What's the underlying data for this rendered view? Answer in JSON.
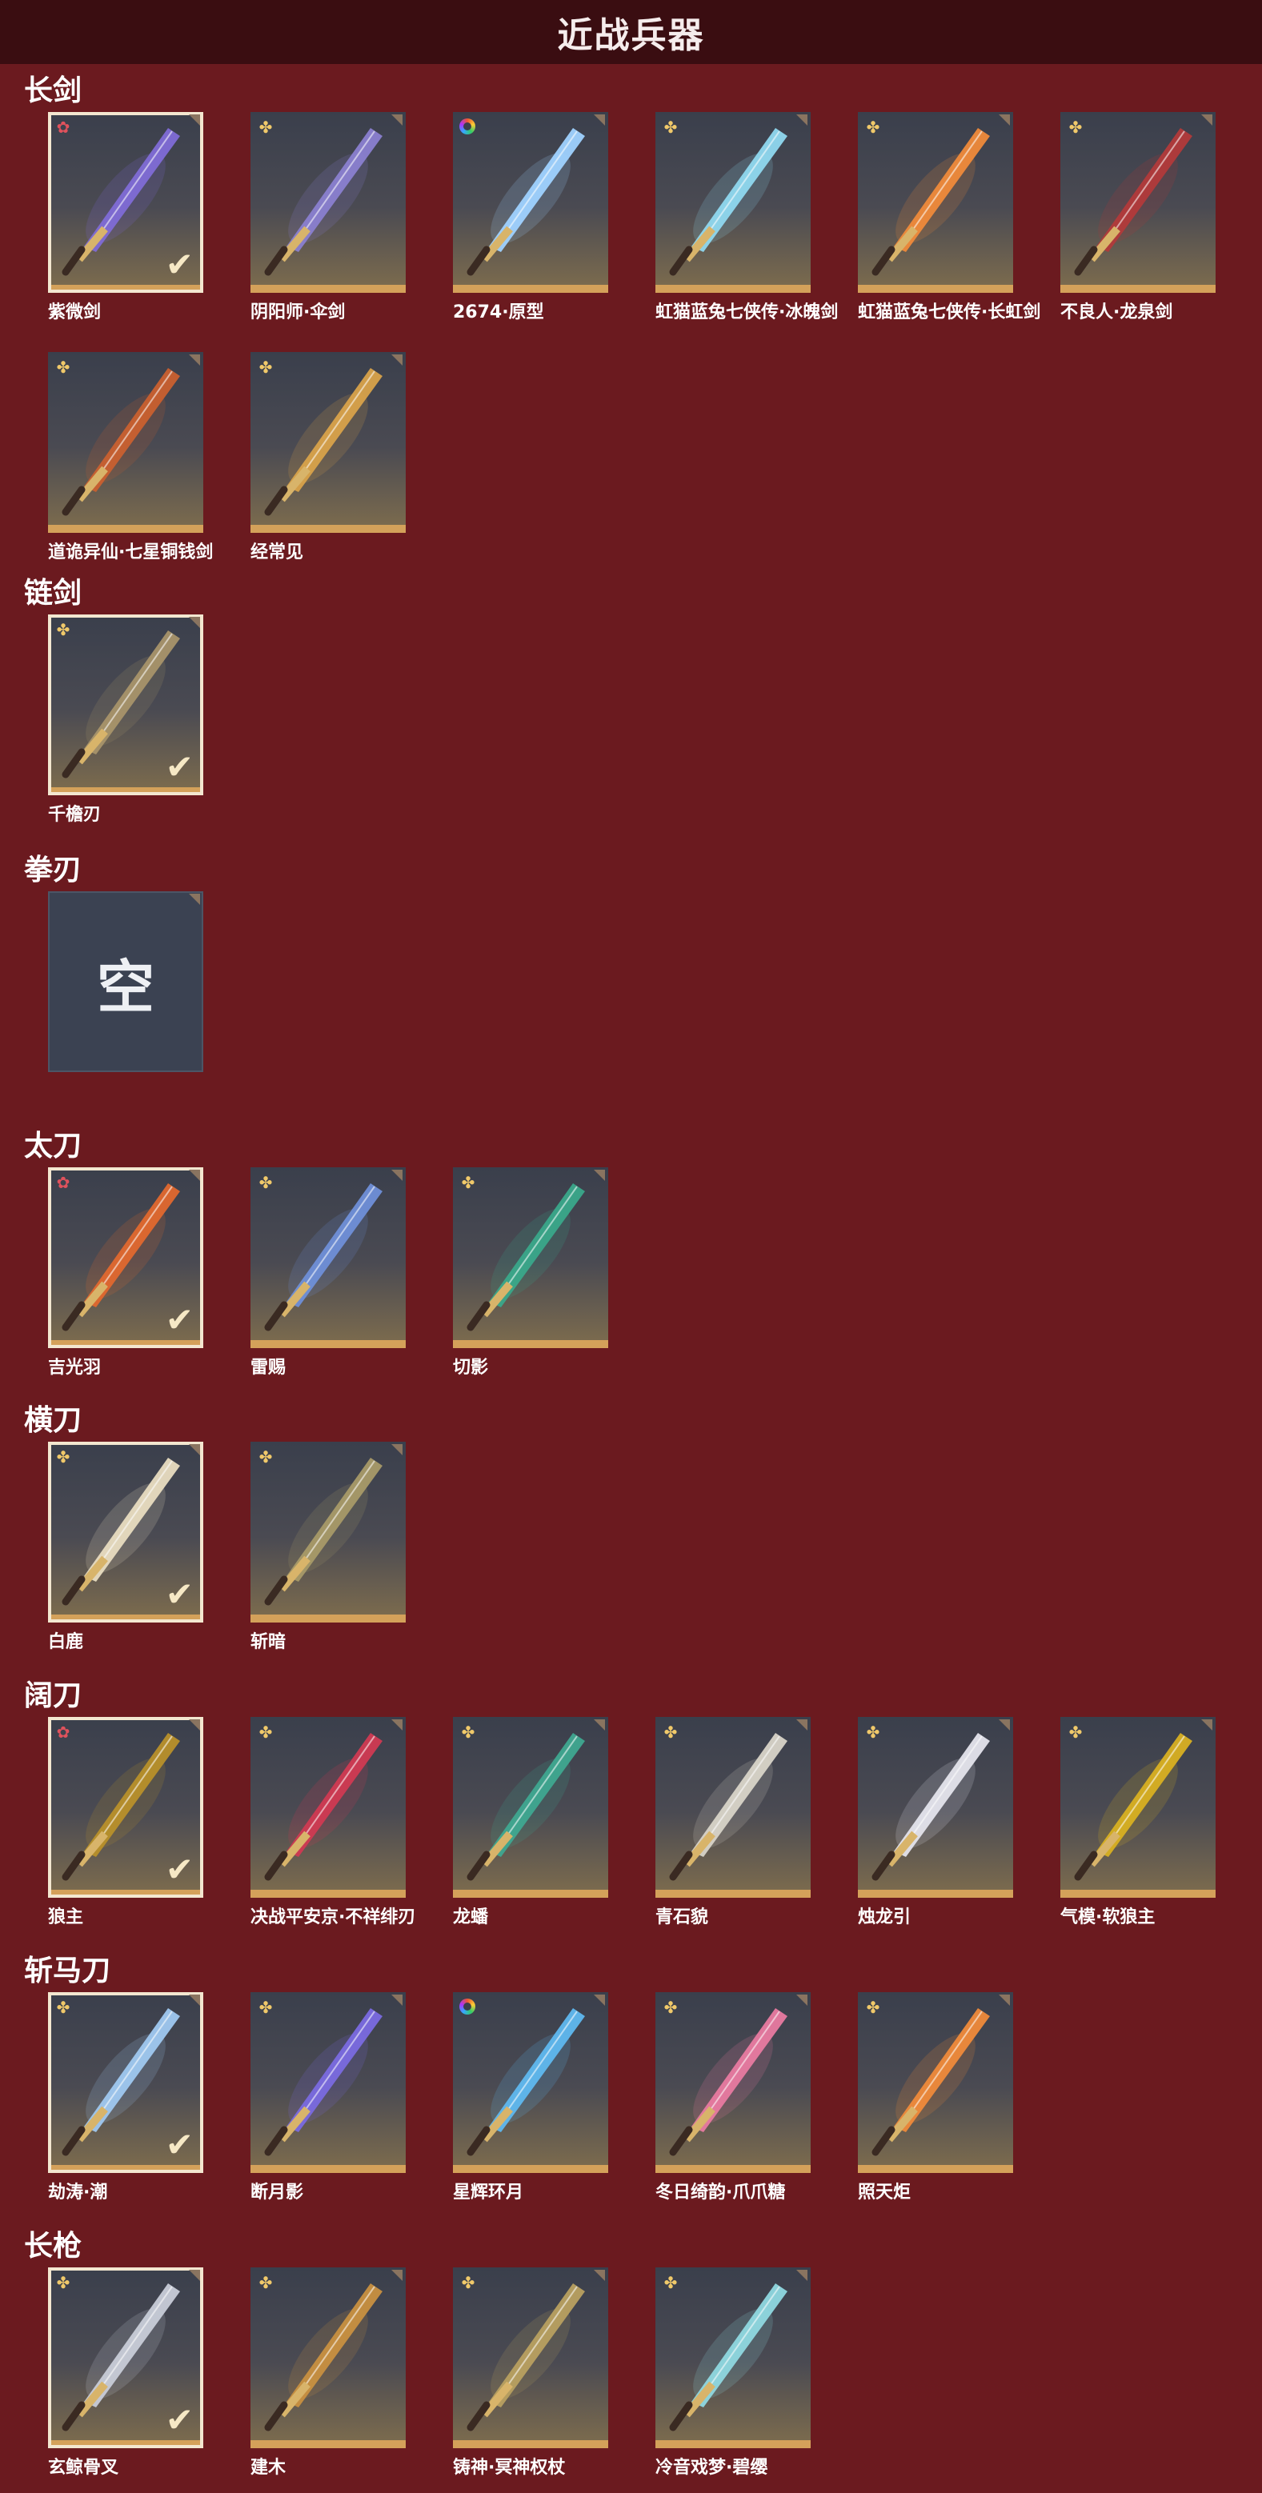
{
  "title": "近战兵器",
  "sections": {
    "changjian": {
      "title": "长剑",
      "items": [
        {
          "name": "紫微剑",
          "rarity": "red",
          "selected": true,
          "weapon_icon": "sword-icon",
          "color": "#7f6bd6"
        },
        {
          "name": "阴阳师·伞剑",
          "rarity": "gold",
          "selected": false,
          "weapon_icon": "umbrella-sword-icon",
          "color": "#8a7fd0"
        },
        {
          "name": "2674·原型",
          "rarity": "rainbow",
          "selected": false,
          "weapon_icon": "lightsaber-icon",
          "color": "#9fd2ff"
        },
        {
          "name": "虹猫蓝兔七侠传·冰魄剑",
          "rarity": "gold",
          "selected": false,
          "weapon_icon": "ice-sword-icon",
          "color": "#8fd8ef"
        },
        {
          "name": "虹猫蓝兔七侠传·长虹剑",
          "rarity": "gold",
          "selected": false,
          "weapon_icon": "fire-sword-icon",
          "color": "#ef8a3a"
        },
        {
          "name": "不良人·龙泉剑",
          "rarity": "gold",
          "selected": false,
          "weapon_icon": "dragon-sword-icon",
          "color": "#b23a3a"
        },
        {
          "name": "道诡异仙·七星铜钱剑",
          "rarity": "gold",
          "selected": false,
          "weapon_icon": "coin-sword-icon",
          "color": "#c9602f"
        },
        {
          "name": "经常见",
          "rarity": "gold",
          "selected": false,
          "weapon_icon": "golden-sword-icon",
          "color": "#d8a24a"
        }
      ]
    },
    "lianjian": {
      "title": "链剑",
      "items": [
        {
          "name": "千檐刃",
          "rarity": "gold",
          "selected": true,
          "weapon_icon": "chain-sword-icon",
          "color": "#a8946a"
        }
      ]
    },
    "quanren": {
      "title": "拳刃",
      "empty_label": "空"
    },
    "taidao": {
      "title": "太刀",
      "items": [
        {
          "name": "吉光羽",
          "rarity": "red",
          "selected": true,
          "weapon_icon": "katana-icon",
          "color": "#e0682e"
        },
        {
          "name": "雷赐",
          "rarity": "gold",
          "selected": false,
          "weapon_icon": "thunder-blade-icon",
          "color": "#6f8fd8"
        },
        {
          "name": "切影",
          "rarity": "gold",
          "selected": false,
          "weapon_icon": "shadow-blade-icon",
          "color": "#3aa88a"
        }
      ]
    },
    "hengdao": {
      "title": "横刀",
      "items": [
        {
          "name": "白鹿",
          "rarity": "gold",
          "selected": true,
          "weapon_icon": "white-saber-icon",
          "color": "#e8dcc0"
        },
        {
          "name": "斩暗",
          "rarity": "gold",
          "selected": false,
          "weapon_icon": "dark-saber-icon",
          "color": "#a89a68"
        }
      ]
    },
    "kuodao": {
      "title": "阔刀",
      "items": [
        {
          "name": "狼主",
          "rarity": "red",
          "selected": true,
          "weapon_icon": "broad-blade-icon",
          "color": "#b8902a"
        },
        {
          "name": "决战平安京·不祥绯刃",
          "rarity": "gold",
          "selected": false,
          "weapon_icon": "crimson-blade-icon",
          "color": "#d03a52"
        },
        {
          "name": "龙蟠",
          "rarity": "gold",
          "selected": false,
          "weapon_icon": "jade-blade-icon",
          "color": "#3fa890"
        },
        {
          "name": "青石貌",
          "rarity": "gold",
          "selected": false,
          "weapon_icon": "stone-blade-icon",
          "color": "#d8d4c8"
        },
        {
          "name": "烛龙引",
          "rarity": "gold",
          "selected": false,
          "weapon_icon": "candle-dragon-blade-icon",
          "color": "#e4e4ec"
        },
        {
          "name": "气模·软狼主",
          "rarity": "gold",
          "selected": false,
          "weapon_icon": "inflatable-blade-icon",
          "color": "#d8b022"
        }
      ]
    },
    "zhanmadao": {
      "title": "斩马刀",
      "items": [
        {
          "name": "劫涛·潮",
          "rarity": "gold",
          "selected": true,
          "weapon_icon": "wave-glaive-icon",
          "color": "#9fc8f0"
        },
        {
          "name": "断月影",
          "rarity": "gold",
          "selected": false,
          "weapon_icon": "moon-glaive-icon",
          "color": "#7a6ae0"
        },
        {
          "name": "星辉环月",
          "rarity": "rainbow",
          "selected": false,
          "weapon_icon": "star-ring-glaive-icon",
          "color": "#5fb8ef"
        },
        {
          "name": "冬日绮韵·爪爪糖",
          "rarity": "gold",
          "selected": false,
          "weapon_icon": "paw-candy-icon",
          "color": "#e87aa0"
        },
        {
          "name": "照天炬",
          "rarity": "gold",
          "selected": false,
          "weapon_icon": "torch-glaive-icon",
          "color": "#ef8a3a"
        }
      ]
    },
    "changqiang": {
      "title": "长枪",
      "items": [
        {
          "name": "玄鲸骨叉",
          "rarity": "gold",
          "selected": true,
          "weapon_icon": "trident-icon",
          "color": "#c8ccd8"
        },
        {
          "name": "建木",
          "rarity": "gold",
          "selected": false,
          "weapon_icon": "wood-spear-icon",
          "color": "#c89040"
        },
        {
          "name": "铸神·冥神权杖",
          "rarity": "gold",
          "selected": false,
          "weapon_icon": "scepter-spear-icon",
          "color": "#b8a060"
        },
        {
          "name": "冷音戏梦·碧缨",
          "rarity": "gold",
          "selected": false,
          "weapon_icon": "jade-spear-icon",
          "color": "#8fd8e0"
        }
      ]
    }
  }
}
